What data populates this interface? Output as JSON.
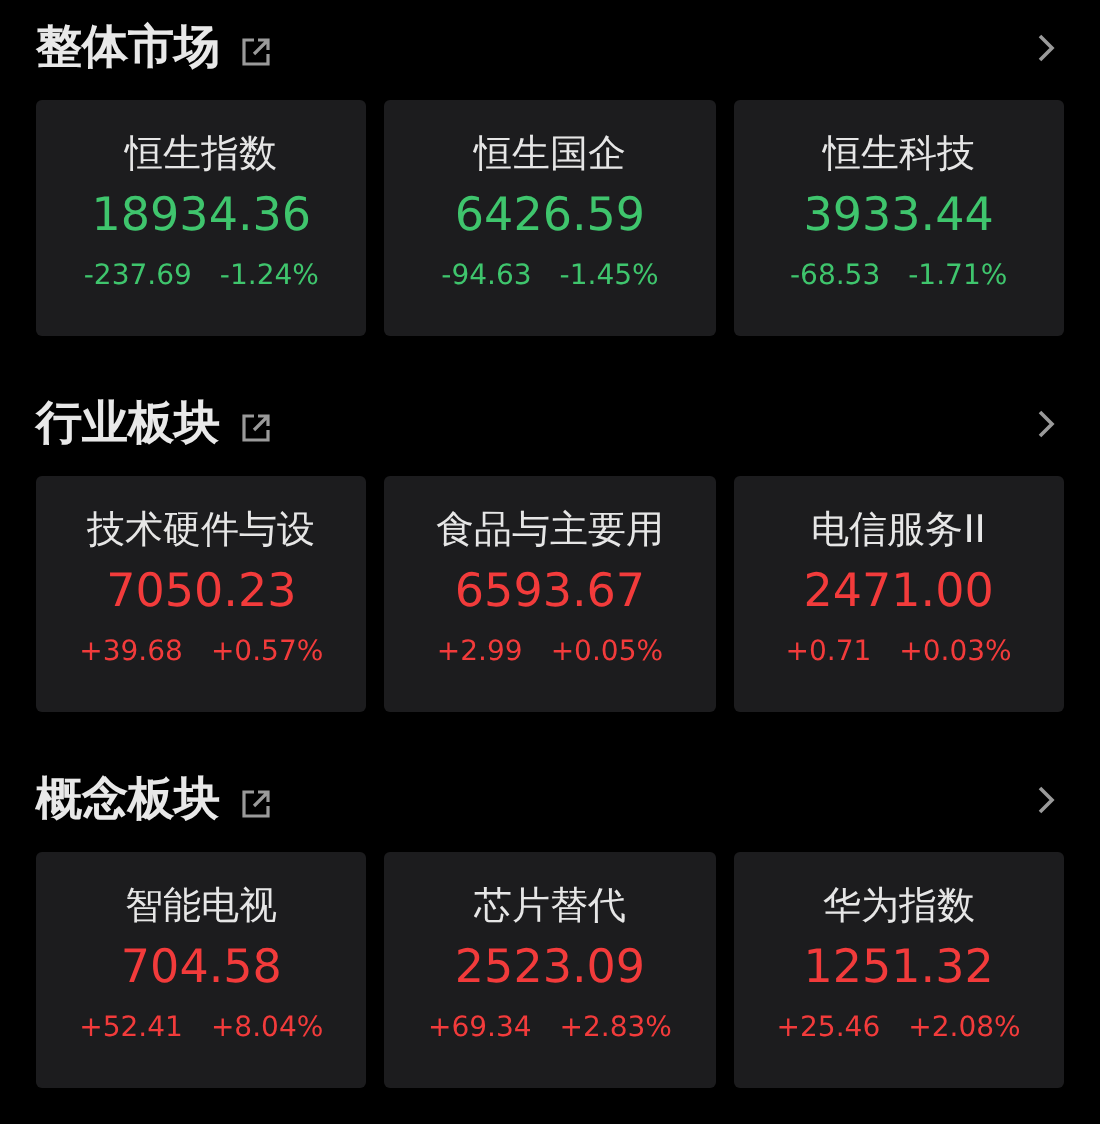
{
  "sections": [
    {
      "title": "整体市场",
      "cards": [
        {
          "name": "恒生指数",
          "value": "18934.36",
          "change": "-237.69",
          "percent": "-1.24%",
          "color": "#3fc56d"
        },
        {
          "name": "恒生国企",
          "value": "6426.59",
          "change": "-94.63",
          "percent": "-1.45%",
          "color": "#3fc56d"
        },
        {
          "name": "恒生科技",
          "value": "3933.44",
          "change": "-68.53",
          "percent": "-1.71%",
          "color": "#3fc56d"
        }
      ]
    },
    {
      "title": "行业板块",
      "cards": [
        {
          "name": "技术硬件与设",
          "value": "7050.23",
          "change": "+39.68",
          "percent": "+0.57%",
          "color": "#f23b3b"
        },
        {
          "name": "食品与主要用",
          "value": "6593.67",
          "change": "+2.99",
          "percent": "+0.05%",
          "color": "#f23b3b"
        },
        {
          "name": "电信服务II",
          "value": "2471.00",
          "change": "+0.71",
          "percent": "+0.03%",
          "color": "#f23b3b"
        }
      ]
    },
    {
      "title": "概念板块",
      "cards": [
        {
          "name": "智能电视",
          "value": "704.58",
          "change": "+52.41",
          "percent": "+8.04%",
          "color": "#f23b3b"
        },
        {
          "name": "芯片替代",
          "value": "2523.09",
          "change": "+69.34",
          "percent": "+2.83%",
          "color": "#f23b3b"
        },
        {
          "name": "华为指数",
          "value": "1251.32",
          "change": "+25.46",
          "percent": "+2.08%",
          "color": "#f23b3b"
        }
      ]
    }
  ]
}
